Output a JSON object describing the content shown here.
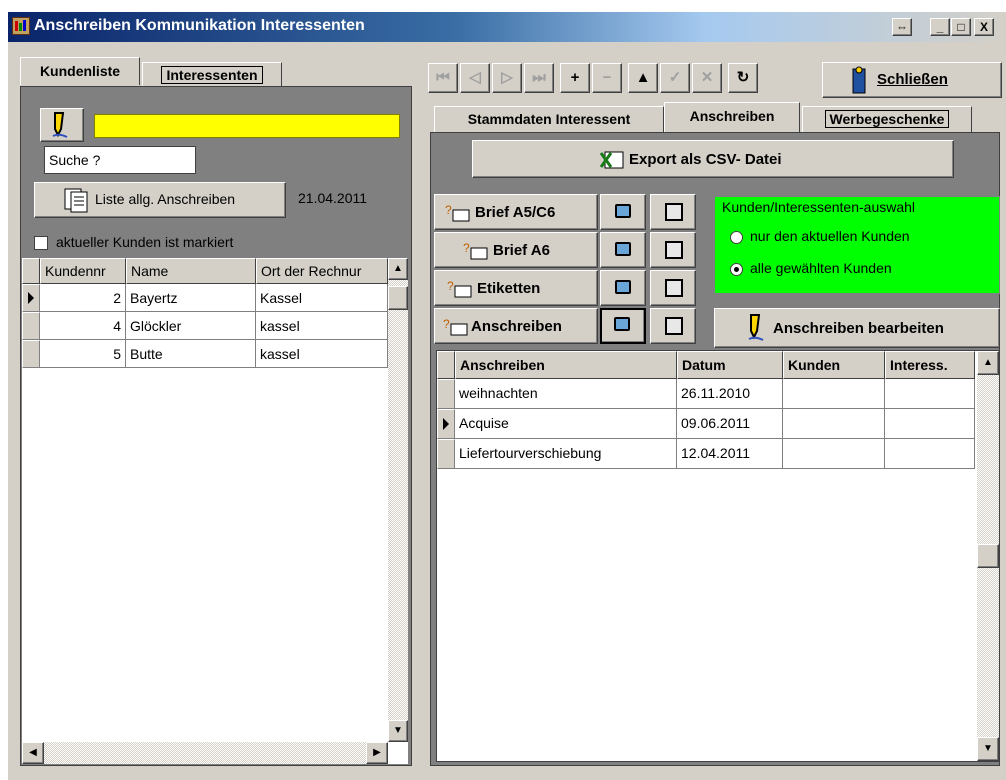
{
  "window": {
    "title": "Anschreiben Kommunikation Interessenten",
    "resize_glyph": "⇔",
    "min_glyph": "_",
    "max_glyph": "□",
    "close_glyph": "X"
  },
  "left_tabs": [
    "Kundenliste",
    "Interessenten"
  ],
  "left": {
    "search_placeholder": "Suche ?",
    "list_button_label": "Liste allg. Anschreiben",
    "date": "21.04.2011",
    "checkbox_label": "aktueller Kunden ist markiert",
    "columns": [
      "Kundennr",
      "Name",
      "Ort der Rechnur"
    ],
    "rows": [
      {
        "nr": "2",
        "name": "Bayertz",
        "ort": "Kassel"
      },
      {
        "nr": "4",
        "name": "Glöckler",
        "ort": "kassel"
      },
      {
        "nr": "5",
        "name": "Butte",
        "ort": "kassel"
      }
    ]
  },
  "toolbar": {
    "nav": [
      "⏮",
      "◁",
      "▷",
      "⏭",
      "+",
      "−",
      "▲",
      "✓",
      "✕",
      "↻"
    ],
    "close_label": "Schließen"
  },
  "right_tabs": [
    "Stammdaten Interessent",
    "Anschreiben",
    "Werbegeschenke"
  ],
  "right": {
    "export_label": "Export als CSV- Datei",
    "letter_buttons": [
      "Brief A5/C6",
      "Brief A6",
      "Etiketten",
      "Anschreiben"
    ],
    "group_label": "Kunden/Interessenten-auswahl",
    "radio_options": [
      "nur den aktuellen Kunden",
      "alle gewählten Kunden"
    ],
    "radio_selected_index": 1,
    "edit_label": "Anschreiben bearbeiten",
    "columns": [
      "Anschreiben",
      "Datum",
      "Kunden",
      "Interess."
    ],
    "rows": [
      {
        "name": "weihnachten",
        "datum": "26.11.2010",
        "kunden": "",
        "interess": ""
      },
      {
        "name": "Acquise",
        "datum": "09.06.2011",
        "kunden": "",
        "interess": ""
      },
      {
        "name": "Liefertourverschiebung",
        "datum": "12.04.2011",
        "kunden": "",
        "interess": ""
      }
    ]
  },
  "colors": {
    "highlight_field": "#ffff00",
    "group_background": "#00ff00",
    "face": "#d4d0c8",
    "title_start": "#0a246a"
  }
}
